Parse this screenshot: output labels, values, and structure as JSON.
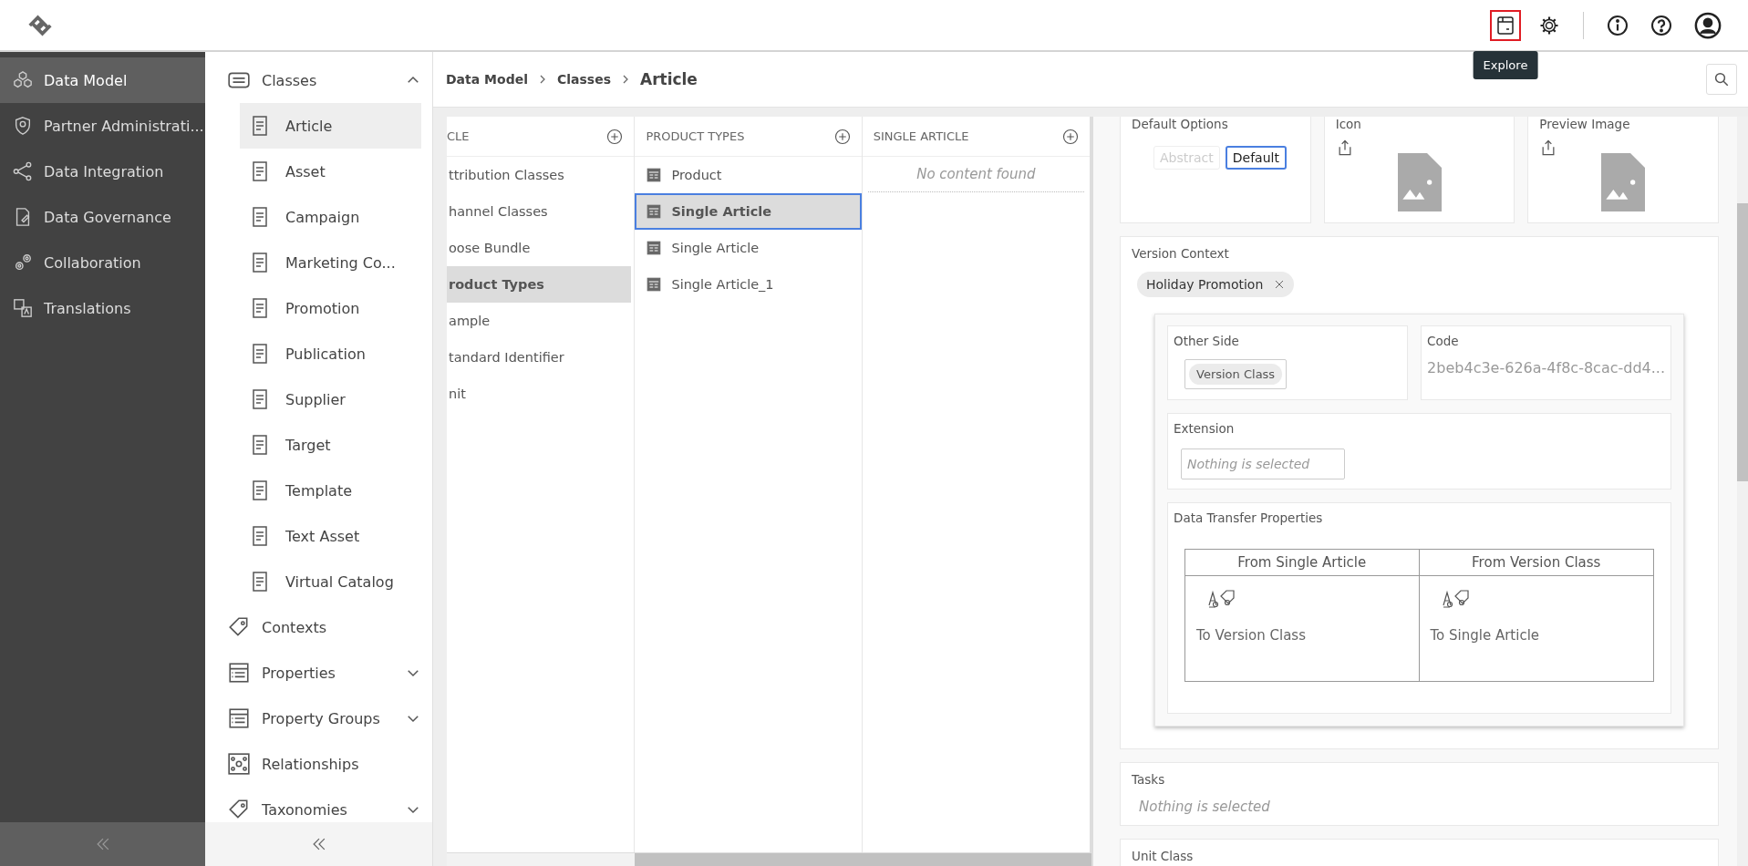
{
  "header": {
    "actions": [
      {
        "kind": "explore",
        "highlighted": true,
        "tooltip": "Explore"
      },
      {
        "kind": "settings",
        "highlighted": false
      },
      {
        "kind": "info",
        "highlighted": false
      },
      {
        "kind": "help",
        "highlighted": false
      },
      {
        "kind": "user",
        "highlighted": false
      }
    ]
  },
  "nav": [
    {
      "label": "Data Model",
      "selected": true
    },
    {
      "label": "Partner Administrati...",
      "selected": false
    },
    {
      "label": "Data Integration",
      "selected": false
    },
    {
      "label": "Data Governance",
      "selected": false
    },
    {
      "label": "Collaboration",
      "selected": false
    },
    {
      "label": "Translations",
      "selected": false
    }
  ],
  "sub_nav": [
    {
      "label": "Classes",
      "expanded": true,
      "children": [
        {
          "label": "Article",
          "selected": true
        },
        {
          "label": "Asset",
          "selected": false
        },
        {
          "label": "Campaign",
          "selected": false
        },
        {
          "label": "Marketing Co...",
          "selected": false
        },
        {
          "label": "Promotion",
          "selected": false
        },
        {
          "label": "Publication",
          "selected": false
        },
        {
          "label": "Supplier",
          "selected": false
        },
        {
          "label": "Target",
          "selected": false
        },
        {
          "label": "Template",
          "selected": false
        },
        {
          "label": "Text Asset",
          "selected": false
        },
        {
          "label": "Virtual Catalog",
          "selected": false
        }
      ]
    },
    {
      "label": "Contexts"
    },
    {
      "label": "Properties",
      "expanded": false
    },
    {
      "label": "Property Groups",
      "expanded": false
    },
    {
      "label": "Relationships"
    },
    {
      "label": "Taxonomies",
      "expanded": false
    }
  ],
  "breadcrumb": [
    "Data Model",
    "Classes",
    "Article"
  ],
  "columns": [
    {
      "title": "CLE",
      "items": [
        {
          "label": "ttribution Classes",
          "selected": false
        },
        {
          "label": "hannel Classes",
          "selected": false
        },
        {
          "label": "oose Bundle",
          "selected": false
        },
        {
          "label": "roduct Types",
          "selected": true
        },
        {
          "label": "ample",
          "selected": false
        },
        {
          "label": "tandard Identifier",
          "selected": false
        },
        {
          "label": "nit",
          "selected": false
        }
      ]
    },
    {
      "title": "PRODUCT TYPES",
      "items": [
        {
          "label": "Product",
          "selected": false,
          "focused": false
        },
        {
          "label": "Single Article",
          "selected": true,
          "focused": true
        },
        {
          "label": "Single Article",
          "selected": false,
          "focused": false
        },
        {
          "label": "Single Article_1",
          "selected": false,
          "focused": false
        }
      ]
    },
    {
      "title": "SINGLE ARTICLE",
      "empty_text": "No content found"
    }
  ],
  "detail": {
    "default_options": {
      "label": "Default Options",
      "options": [
        {
          "label": "Abstract",
          "selected": false
        },
        {
          "label": "Default",
          "selected": true
        }
      ]
    },
    "icon": {
      "label": "Icon"
    },
    "preview_image": {
      "label": "Preview Image"
    },
    "version_context": {
      "label": "Version Context",
      "chips": [
        "Holiday Promotion"
      ],
      "other_side": {
        "label": "Other Side",
        "chip": "Version Class"
      },
      "code": {
        "label": "Code",
        "value": "2beb4c3e-626a-4f8c-8cac-dd4..."
      },
      "extension": {
        "label": "Extension",
        "placeholder": "Nothing is selected"
      },
      "data_transfer": {
        "label": "Data Transfer Properties",
        "columns": [
          "From Single Article",
          "From Version Class"
        ],
        "cells": [
          "To Version Class",
          "To Single Article"
        ]
      }
    },
    "tasks": {
      "label": "Tasks",
      "placeholder": "Nothing is selected"
    },
    "unit_class": {
      "label": "Unit Class"
    }
  }
}
